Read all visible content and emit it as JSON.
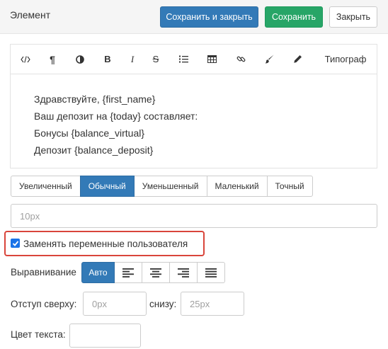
{
  "header": {
    "title": "Элемент",
    "save_close_label": "Сохранить и закрыть",
    "save_label": "Сохранить",
    "close_label": "Закрыть"
  },
  "toolbar": {
    "items": [
      "code-icon",
      "paragraph-icon",
      "contrast-icon",
      "bold-icon",
      "italic-icon",
      "strikethrough-icon",
      "list-icon",
      "table-icon",
      "link-icon",
      "brush-icon",
      "pencil-icon"
    ],
    "bold_glyph": "B",
    "italic_glyph": "I",
    "strike_glyph": "S",
    "paragraph_glyph": "¶",
    "typograph_label": "Типограф"
  },
  "editor": {
    "lines": [
      "Здравствуйте, {first_name}",
      "Ваш депозит на {today} составляет:",
      "Бонусы {balance_virtual}",
      "Депозит {balance_deposit}"
    ]
  },
  "size_options": {
    "items": [
      "Увеличенный",
      "Обычный",
      "Уменьшенный",
      "Маленький",
      "Точный"
    ],
    "active": "Обычный"
  },
  "size_input": {
    "placeholder": "10px"
  },
  "replace_vars": {
    "label": "Заменять переменные пользователя",
    "checked": true
  },
  "alignment": {
    "label": "Выравнивание",
    "auto_label": "Авто",
    "options": [
      "align-left-icon",
      "align-center-icon",
      "align-right-icon",
      "align-justify-icon"
    ]
  },
  "margins": {
    "top_label": "Отступ сверху:",
    "top_placeholder": "0px",
    "bottom_label": "снизу:",
    "bottom_placeholder": "25px"
  },
  "text_color": {
    "label": "Цвет текста:"
  },
  "colors": {
    "primary": "#337ab7",
    "success": "#27a567",
    "highlight": "#d9453b",
    "checkbox": "#1a73e8"
  }
}
